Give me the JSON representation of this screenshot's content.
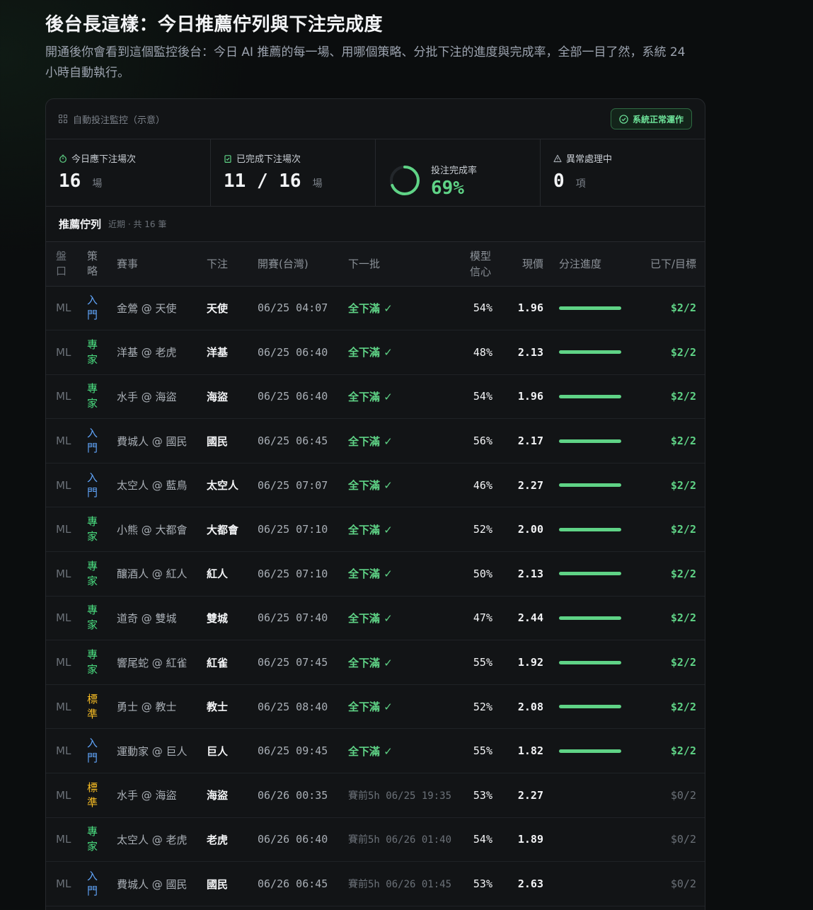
{
  "heading": "後台長這樣：今日推薦佇列與下注完成度",
  "subtitle": "開通後你會看到這個監控後台：今日 AI 推薦的每一場、用哪個策略、分批下注的進度與完成率，全部一目了然，系統 24 小時自動執行。",
  "panel": {
    "title": "自動投注監控（示意）",
    "status": "系統正常運作"
  },
  "stats": {
    "today": {
      "label": "今日應下注場次",
      "value": "16",
      "unit": "場"
    },
    "completed": {
      "label": "已完成下注場次",
      "value": "11 / 16",
      "unit": "場"
    },
    "rate": {
      "label": "投注完成率",
      "value": "69%",
      "fraction": 0.69
    },
    "exceptions": {
      "label": "異常處理中",
      "value": "0",
      "unit": "項"
    }
  },
  "queue": {
    "title": "推薦佇列",
    "subtitle": "近期 · 共 16 筆"
  },
  "columns": {
    "market": "盤口",
    "strategy": "策略",
    "match": "賽事",
    "pick": "下注",
    "start": "開賽(台灣)",
    "batch": "下一批",
    "confidence": "模型信心",
    "price": "現價",
    "progress": "分注進度",
    "placed": "已下/目標"
  },
  "colors": {
    "accent_green": "#5fd386",
    "strategy_beginner": "#60a5fa",
    "strategy_expert": "#4ade80",
    "strategy_standard": "#fbbf24"
  },
  "rows": [
    {
      "market": "ML",
      "strategy": "入門",
      "tone": "blue",
      "match": "金鶯 @ 天使",
      "pick": "天使",
      "start": "06/25 04:07",
      "batch": "全下滿 ✓",
      "done": true,
      "confidence": "54%",
      "price": "1.96",
      "progress": 1,
      "placed": "$2/2"
    },
    {
      "market": "ML",
      "strategy": "專家",
      "tone": "green",
      "match": "洋基 @ 老虎",
      "pick": "洋基",
      "start": "06/25 06:40",
      "batch": "全下滿 ✓",
      "done": true,
      "confidence": "48%",
      "price": "2.13",
      "progress": 1,
      "placed": "$2/2"
    },
    {
      "market": "ML",
      "strategy": "專家",
      "tone": "green",
      "match": "水手 @ 海盜",
      "pick": "海盜",
      "start": "06/25 06:40",
      "batch": "全下滿 ✓",
      "done": true,
      "confidence": "54%",
      "price": "1.96",
      "progress": 1,
      "placed": "$2/2"
    },
    {
      "market": "ML",
      "strategy": "入門",
      "tone": "blue",
      "match": "費城人 @ 國民",
      "pick": "國民",
      "start": "06/25 06:45",
      "batch": "全下滿 ✓",
      "done": true,
      "confidence": "56%",
      "price": "2.17",
      "progress": 1,
      "placed": "$2/2"
    },
    {
      "market": "ML",
      "strategy": "入門",
      "tone": "blue",
      "match": "太空人 @ 藍鳥",
      "pick": "太空人",
      "start": "06/25 07:07",
      "batch": "全下滿 ✓",
      "done": true,
      "confidence": "46%",
      "price": "2.27",
      "progress": 1,
      "placed": "$2/2"
    },
    {
      "market": "ML",
      "strategy": "專家",
      "tone": "green",
      "match": "小熊 @ 大都會",
      "pick": "大都會",
      "start": "06/25 07:10",
      "batch": "全下滿 ✓",
      "done": true,
      "confidence": "52%",
      "price": "2.00",
      "progress": 1,
      "placed": "$2/2"
    },
    {
      "market": "ML",
      "strategy": "專家",
      "tone": "green",
      "match": "釀酒人 @ 紅人",
      "pick": "紅人",
      "start": "06/25 07:10",
      "batch": "全下滿 ✓",
      "done": true,
      "confidence": "50%",
      "price": "2.13",
      "progress": 1,
      "placed": "$2/2"
    },
    {
      "market": "ML",
      "strategy": "專家",
      "tone": "green",
      "match": "道奇 @ 雙城",
      "pick": "雙城",
      "start": "06/25 07:40",
      "batch": "全下滿 ✓",
      "done": true,
      "confidence": "47%",
      "price": "2.44",
      "progress": 1,
      "placed": "$2/2"
    },
    {
      "market": "ML",
      "strategy": "專家",
      "tone": "green",
      "match": "響尾蛇 @ 紅雀",
      "pick": "紅雀",
      "start": "06/25 07:45",
      "batch": "全下滿 ✓",
      "done": true,
      "confidence": "55%",
      "price": "1.92",
      "progress": 1,
      "placed": "$2/2"
    },
    {
      "market": "ML",
      "strategy": "標準",
      "tone": "amber",
      "match": "勇士 @ 教士",
      "pick": "教士",
      "start": "06/25 08:40",
      "batch": "全下滿 ✓",
      "done": true,
      "confidence": "52%",
      "price": "2.08",
      "progress": 1,
      "placed": "$2/2"
    },
    {
      "market": "ML",
      "strategy": "入門",
      "tone": "blue",
      "match": "運動家 @ 巨人",
      "pick": "巨人",
      "start": "06/25 09:45",
      "batch": "全下滿 ✓",
      "done": true,
      "confidence": "55%",
      "price": "1.82",
      "progress": 1,
      "placed": "$2/2"
    },
    {
      "market": "ML",
      "strategy": "標準",
      "tone": "amber",
      "match": "水手 @ 海盜",
      "pick": "海盜",
      "start": "06/26 00:35",
      "batch": "賽前5h 06/25 19:35",
      "done": false,
      "confidence": "53%",
      "price": "2.27",
      "progress": 0,
      "placed": "$0/2"
    },
    {
      "market": "ML",
      "strategy": "專家",
      "tone": "green",
      "match": "太空人 @ 老虎",
      "pick": "老虎",
      "start": "06/26 06:40",
      "batch": "賽前5h 06/26 01:40",
      "done": false,
      "confidence": "54%",
      "price": "1.89",
      "progress": 0,
      "placed": "$0/2"
    },
    {
      "market": "ML",
      "strategy": "入門",
      "tone": "blue",
      "match": "費城人 @ 國民",
      "pick": "國民",
      "start": "06/26 06:45",
      "batch": "賽前5h 06/26 01:45",
      "done": false,
      "confidence": "53%",
      "price": "2.63",
      "progress": 0,
      "placed": "$0/2"
    }
  ]
}
